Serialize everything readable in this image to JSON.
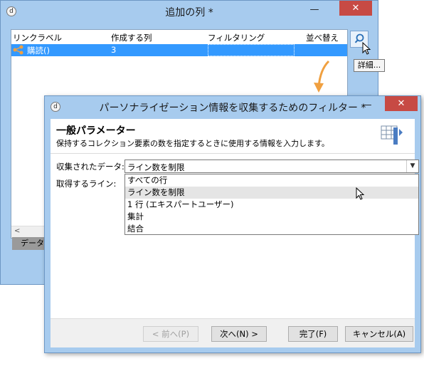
{
  "back_window": {
    "title": "追加の列 *",
    "close_glyph": "✕",
    "min_glyph": "—",
    "columns": [
      "リンクラベル",
      "作成する列",
      "フィルタリング",
      "並べ替え"
    ],
    "rows": [
      {
        "label": "購読()",
        "count": "3",
        "filter": "",
        "sort": ""
      }
    ],
    "tooltip": "詳細...",
    "data_tab": "データ"
  },
  "front_window": {
    "title": "パーソナライゼーション情報を収集するためのフィルター *",
    "close_glyph": "✕",
    "min_glyph": "—",
    "section_title": "一般パラメーター",
    "section_desc": "保持するコレクション要素の数を指定するときに使用する情報を入力します。",
    "collected_data_label": "収集されたデータ:",
    "collected_data_value": "ライン数を制限",
    "lines_to_get_label": "取得するライン:",
    "dropdown_options": [
      "すべての行",
      "ライン数を制限",
      "1 行 (エキスパートユーザー)",
      "集計",
      "結合"
    ],
    "hovered_option_index": 1,
    "buttons": {
      "prev": "< 前へ(P)",
      "next": "次へ(N) >",
      "finish": "完了(F)",
      "cancel": "キャンセル(A)"
    }
  },
  "colors": {
    "title_bg": "#a7cbee",
    "selection": "#3399ff",
    "close": "#c74a44",
    "arrow": "#f0a040"
  }
}
